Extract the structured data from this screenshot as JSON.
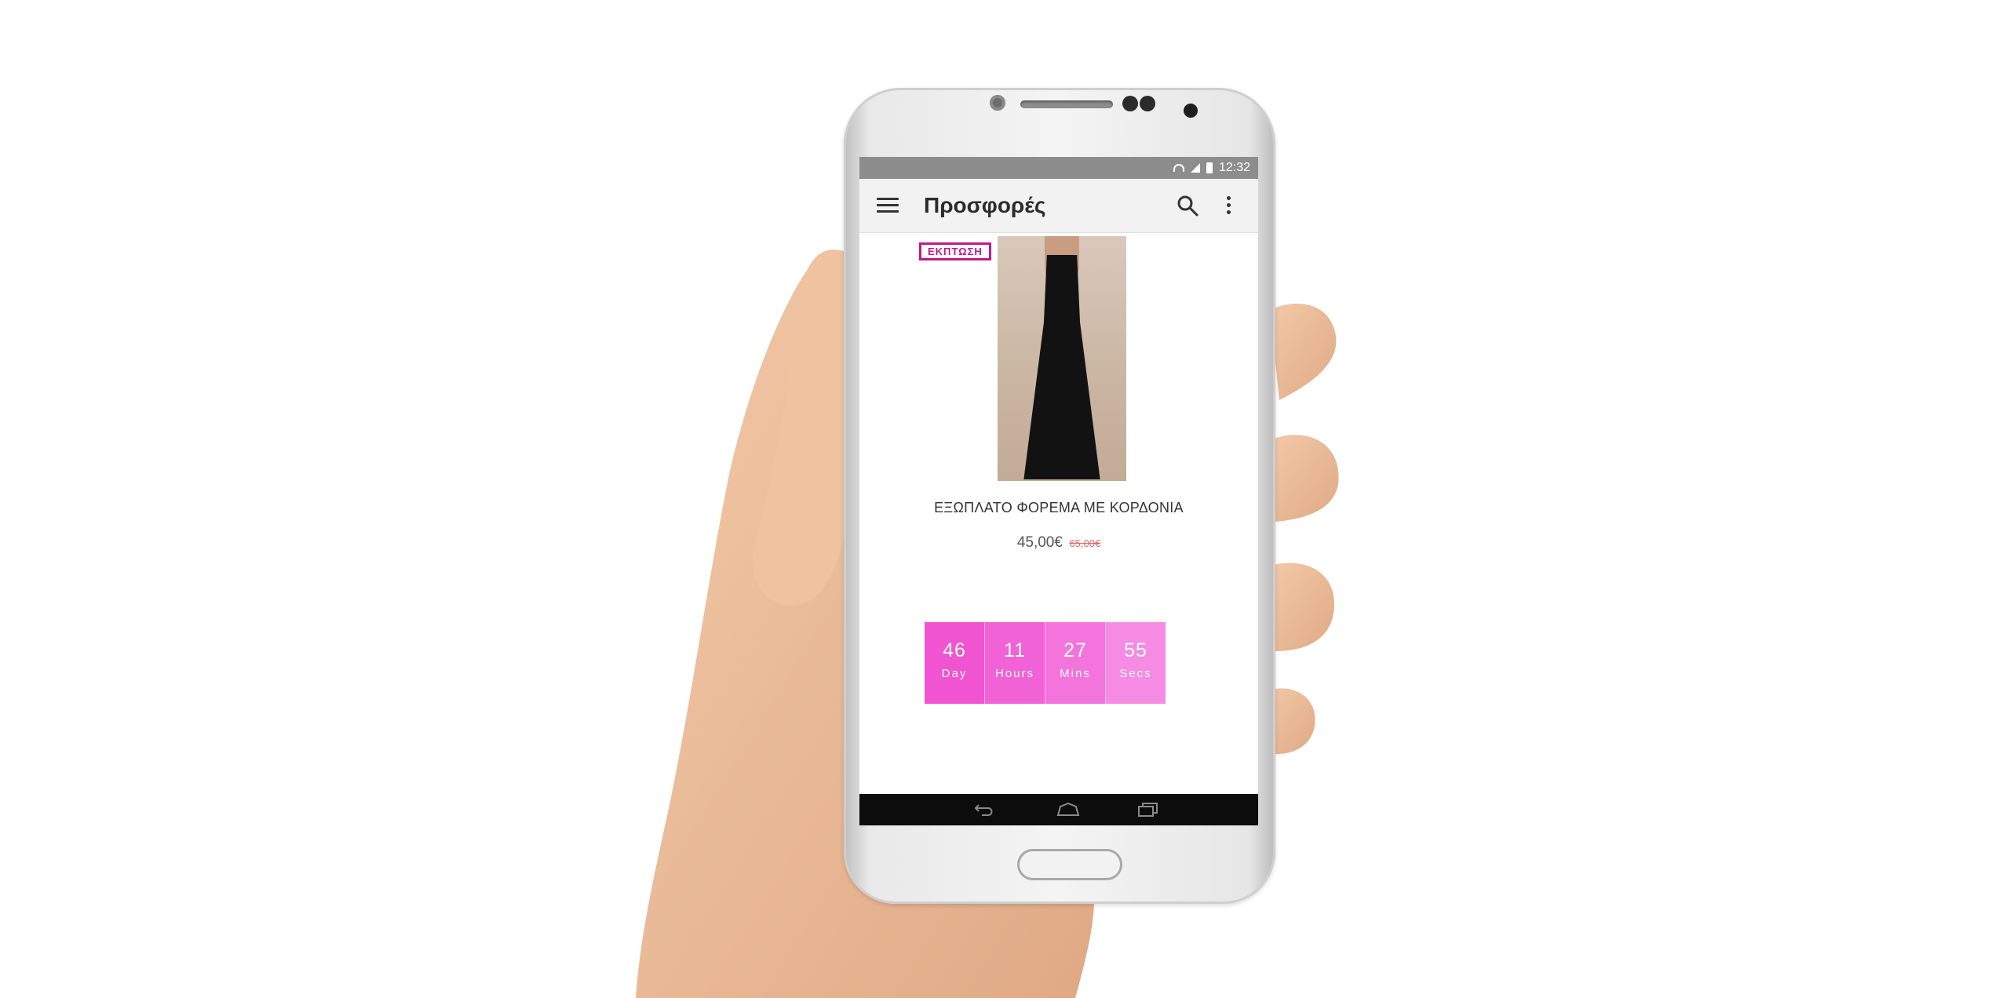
{
  "status_bar": {
    "time": "12:32",
    "icons": [
      "wifi-icon",
      "signal-icon",
      "battery-icon"
    ]
  },
  "app_bar": {
    "menu_icon": "hamburger-menu-icon",
    "title": "Προσφορές",
    "search_icon": "search-icon",
    "more_icon": "more-vertical-icon"
  },
  "product": {
    "badge": "ΕΚΠΤΩΣΗ",
    "image": "black-maxi-dress-image",
    "title": "ΕΞΩΠΛΑΤΟ ΦΟΡΕΜΑ ΜΕ ΚΟΡΔΟΝΙΑ",
    "price_current": "45,00€",
    "price_original": "65,00€"
  },
  "countdown": [
    {
      "value": "46",
      "label": "Day",
      "color": "#f054d0"
    },
    {
      "value": "11",
      "label": "Hours",
      "color": "#f062d6"
    },
    {
      "value": "27",
      "label": "Mins",
      "color": "#f374dc"
    },
    {
      "value": "55",
      "label": "Secs",
      "color": "#f68be3"
    }
  ],
  "nav_bar": {
    "icons": [
      "back-icon",
      "home-icon",
      "recent-apps-icon"
    ]
  },
  "colors": {
    "accent": "#c2188d",
    "status_bar": "#8d8d8d",
    "app_bar": "#f2f2f2",
    "nav_bar": "#0c0c0c"
  }
}
